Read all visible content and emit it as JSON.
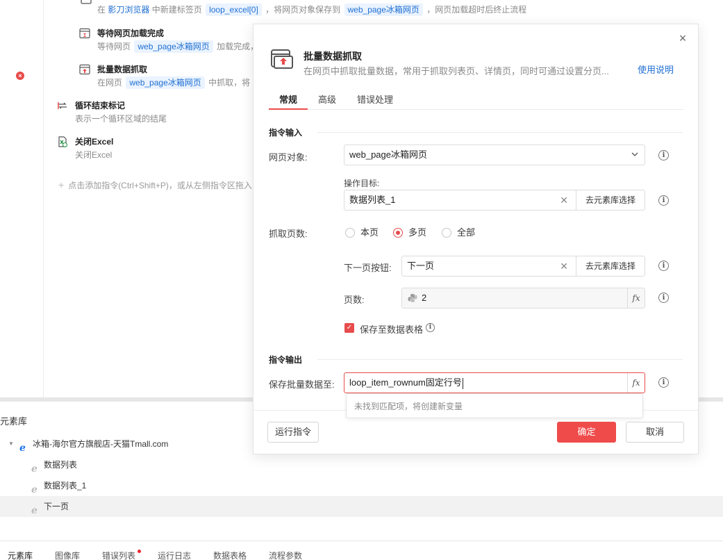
{
  "flow": {
    "steps": [
      {
        "desc_parts": [
          "在",
          "影刀浏览器",
          "中新建标签页",
          "loop_excel[0]",
          "，将网页对象保存到",
          "web_page冰箱网页",
          "，网页加载超时后终止流程"
        ]
      },
      {
        "title": "等待网页加载完成",
        "desc_prefix": "等待网页",
        "desc_tag": "web_page冰箱网页",
        "desc_suffix": "加载完成，"
      },
      {
        "title": "批量数据抓取",
        "desc_prefix": "在网页",
        "desc_tag": "web_page冰箱网页",
        "desc_suffix": "中抓取，将"
      },
      {
        "title": "循环结束标记",
        "desc": "表示一个循环区域的结尾"
      },
      {
        "title": "关闭Excel",
        "desc": "关闭Excel"
      }
    ],
    "error_badge": "×",
    "add_hint": "点击添加指令(Ctrl+Shift+P)，或从左侧指令区拖入"
  },
  "library": {
    "title": "元素库",
    "root": "冰箱-海尔官方旗舰店-天猫Tmall.com",
    "items": [
      "数据列表",
      "数据列表_1",
      "下一页"
    ]
  },
  "bottom_tabs": [
    "元素库",
    "图像库",
    "错误列表",
    "运行日志",
    "数据表格",
    "流程参数"
  ],
  "dialog": {
    "title": "批量数据抓取",
    "subtitle": "在网页中抓取批量数据，常用于抓取列表页、详情页，同时可通过设置分页...",
    "help": "使用说明",
    "close": "×",
    "tabs": [
      "常规",
      "高级",
      "错误处理"
    ],
    "section_input": "指令输入",
    "section_output": "指令输出",
    "webpage_label": "网页对象:",
    "webpage_value": "web_page冰箱网页",
    "target_label": "操作目标:",
    "target_value": "数据列表_1",
    "pick_label": "去元素库选择",
    "pages_label": "抓取页数:",
    "page_options": [
      "本页",
      "多页",
      "全部"
    ],
    "page_selected": "多页",
    "next_btn_label": "下一页按钮:",
    "next_btn_value": "下一页",
    "page_count_label": "页数:",
    "page_count_value": "2",
    "save_table_label": "保存至数据表格",
    "save_table_checked": true,
    "output_label": "保存批量数据至:",
    "output_value": "loop_item_rownum固定行号",
    "suggest_text": "未找到匹配项，将创建新变量",
    "fx": "fx",
    "run_label": "运行指令",
    "ok_label": "确定",
    "cancel_label": "取消"
  },
  "colors": {
    "accent": "#e84b4b",
    "link": "#1f6fd1",
    "tag_bg": "#eaf3ff"
  }
}
